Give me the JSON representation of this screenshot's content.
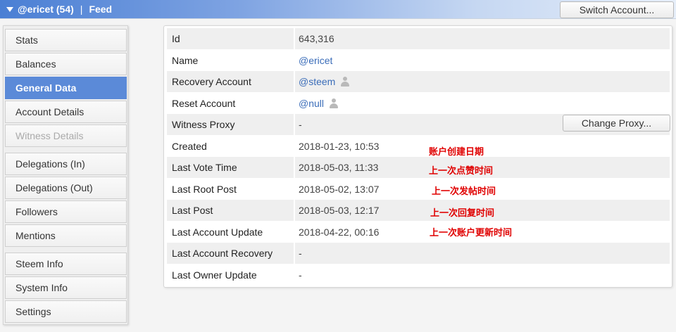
{
  "header": {
    "account": "@ericet (54)",
    "separator": "|",
    "feed": "Feed",
    "switch_account": "Switch Account..."
  },
  "sidebar": {
    "items": [
      {
        "label": "Stats",
        "state": "normal"
      },
      {
        "label": "Balances",
        "state": "normal"
      },
      {
        "label": "General Data",
        "state": "active"
      },
      {
        "label": "Account Details",
        "state": "normal"
      },
      {
        "label": "Witness Details",
        "state": "disabled"
      },
      {
        "label": "Delegations (In)",
        "state": "normal"
      },
      {
        "label": "Delegations (Out)",
        "state": "normal"
      },
      {
        "label": "Followers",
        "state": "normal"
      },
      {
        "label": "Mentions",
        "state": "normal"
      },
      {
        "label": "Steem Info",
        "state": "normal"
      },
      {
        "label": "System Info",
        "state": "normal"
      },
      {
        "label": "Settings",
        "state": "normal"
      }
    ]
  },
  "general_data": {
    "rows": [
      {
        "label": "Id",
        "value": "643,316"
      },
      {
        "label": "Name",
        "value": "@ericet"
      },
      {
        "label": "Recovery Account",
        "value": "@steem"
      },
      {
        "label": "Reset Account",
        "value": "@null"
      },
      {
        "label": "Witness Proxy",
        "value": "-"
      },
      {
        "label": "Created",
        "value": "2018-01-23, 10:53"
      },
      {
        "label": "Last Vote Time",
        "value": "2018-05-03, 11:33"
      },
      {
        "label": "Last Root Post",
        "value": "2018-05-02, 13:07"
      },
      {
        "label": "Last Post",
        "value": "2018-05-03, 12:17"
      },
      {
        "label": "Last Account Update",
        "value": "2018-04-22, 00:16"
      },
      {
        "label": "Last Account Recovery",
        "value": "-"
      },
      {
        "label": "Last Owner Update",
        "value": "-"
      }
    ],
    "change_proxy": "Change Proxy..."
  },
  "annotations": {
    "created": "账户创建日期",
    "last_vote": "上一次点赞时间",
    "last_root_post": "上一次发帖时间",
    "last_post": "上一次回复时间",
    "last_account_update": "上一次账户更新时间"
  },
  "colors": {
    "accent": "#5b8ad8",
    "link": "#3b6db9",
    "annotation": "#e00000"
  }
}
